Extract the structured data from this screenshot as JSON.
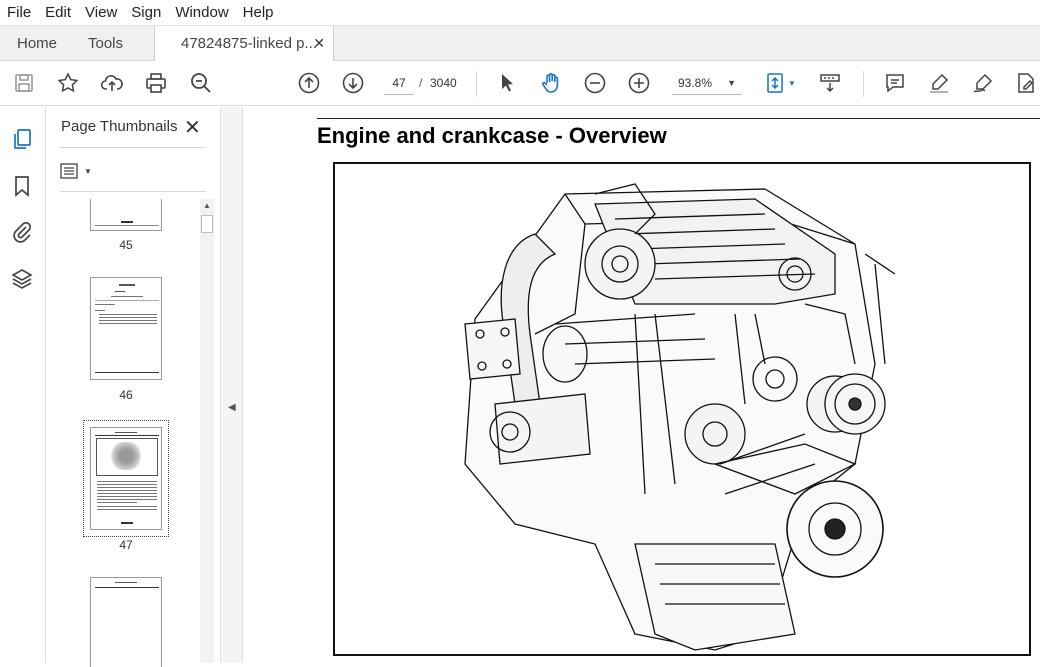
{
  "menu": [
    "File",
    "Edit",
    "View",
    "Sign",
    "Window",
    "Help"
  ],
  "tabs": {
    "home": "Home",
    "tools": "Tools",
    "document": "47824875-linked p...",
    "close": "✕"
  },
  "toolbar": {
    "current_page": "47",
    "page_separator": "/",
    "total_pages": "3040",
    "zoom": "93.8%"
  },
  "thumbnails_panel": {
    "title": "Page Thumbnails",
    "close": "✕",
    "pages": [
      "45",
      "46",
      "47"
    ]
  },
  "document": {
    "heading": "Engine and crankcase - Overview"
  }
}
